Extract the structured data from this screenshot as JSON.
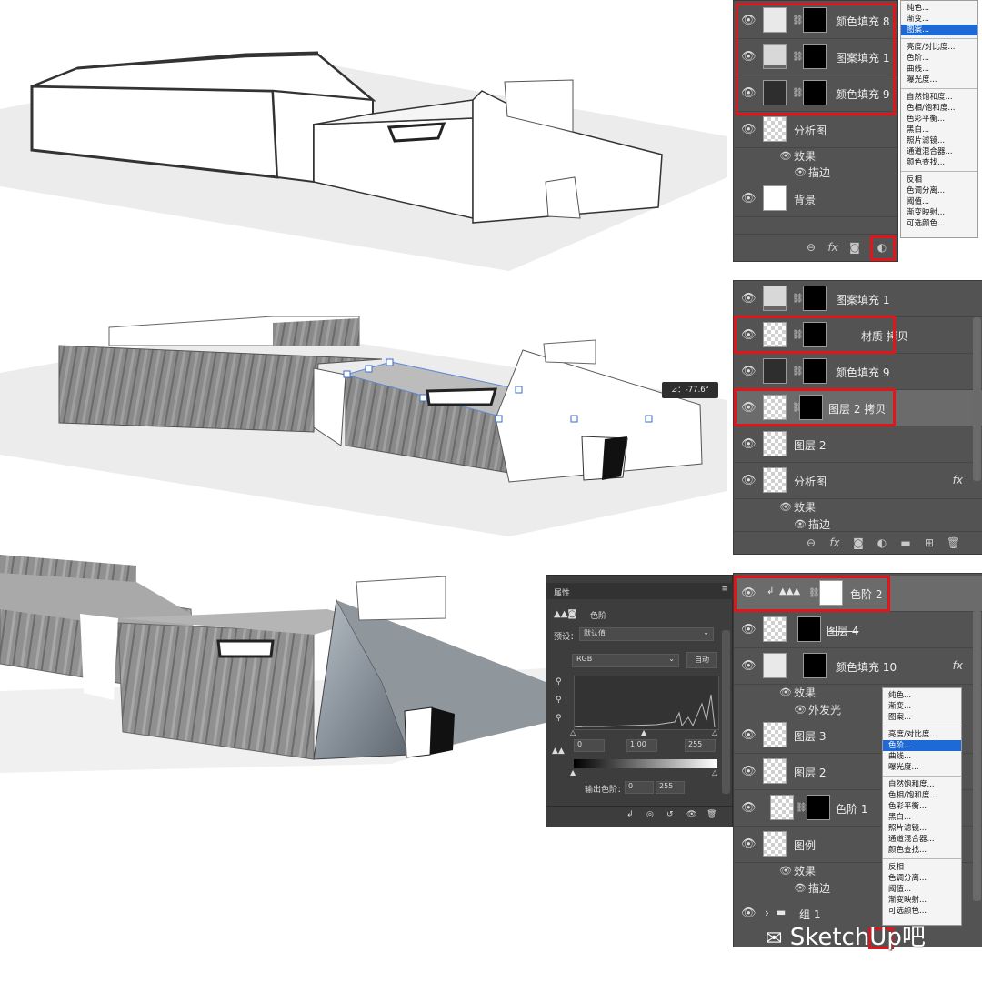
{
  "panel1": {
    "layers": [
      {
        "name": "颜色填充 8"
      },
      {
        "name": "图案填充 1"
      },
      {
        "name": "颜色填充 9"
      },
      {
        "name": "分析图"
      },
      {
        "name": "背景"
      }
    ],
    "effects_label": "效果",
    "stroke_label": "描边"
  },
  "menu1": {
    "groups": [
      [
        "纯色...",
        "渐变...",
        "图案..."
      ],
      [
        "亮度/对比度...",
        "色阶...",
        "曲线...",
        "曝光度..."
      ],
      [
        "自然饱和度...",
        "色相/饱和度...",
        "色彩平衡...",
        "黑白...",
        "照片滤镜...",
        "通道混合器...",
        "颜色查找..."
      ],
      [
        "反相",
        "色调分离...",
        "阈值...",
        "渐变映射...",
        "可选颜色..."
      ]
    ],
    "highlighted": "图案..."
  },
  "panel2": {
    "layers": [
      {
        "name": "图案填充 1"
      },
      {
        "name": "材质 拷贝"
      },
      {
        "name": "颜色填充 9"
      },
      {
        "name": "图层 2 拷贝"
      },
      {
        "name": "图层 2"
      },
      {
        "name": "分析图"
      }
    ],
    "effects_label": "效果",
    "stroke_label": "描边"
  },
  "tooltip": "⊿：-77.6°",
  "properties": {
    "tab": "属性",
    "title": "色阶",
    "preset_label": "预设：",
    "preset_value": "默认值",
    "channel": "RGB",
    "auto_button": "自动",
    "input_black": "0",
    "input_gamma": "1.00",
    "input_white": "255",
    "output_label": "输出色阶：",
    "output_black": "0",
    "output_white": "255"
  },
  "panel3": {
    "layers": [
      {
        "name": "色阶 2"
      },
      {
        "name": "图层 4"
      },
      {
        "name": "颜色填充 10"
      },
      {
        "name": "图层 3"
      },
      {
        "name": "图层 2"
      },
      {
        "name": "色阶 1"
      },
      {
        "name": "图例"
      },
      {
        "name": "组 1"
      }
    ],
    "effects_label": "效果",
    "glow_label": "外发光",
    "stroke_label": "描边"
  },
  "menu3": {
    "groups": [
      [
        "纯色...",
        "渐变...",
        "图案..."
      ],
      [
        "亮度/对比度...",
        "色阶...",
        "曲线...",
        "曝光度..."
      ],
      [
        "自然饱和度...",
        "色相/饱和度...",
        "色彩平衡...",
        "黑白...",
        "照片滤镜...",
        "通道混合器...",
        "颜色查找..."
      ],
      [
        "反相",
        "色调分离...",
        "阈值...",
        "渐变映射...",
        "可选颜色..."
      ]
    ],
    "highlighted": "色阶..."
  },
  "watermark": "SketchUp吧",
  "colors": {
    "panel": "#535353",
    "red": "#e0161b",
    "menu_highlight": "#1d6ad6"
  }
}
